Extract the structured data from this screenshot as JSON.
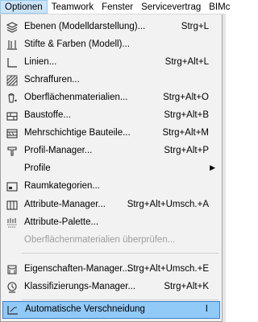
{
  "menubar": {
    "items": [
      "Optionen",
      "Teamwork",
      "Fenster",
      "Servicevertrag",
      "BIMc"
    ]
  },
  "menu": {
    "items": [
      {
        "label": "Ebenen (Modelldarstellung)...",
        "shortcut": "Strg+L",
        "icon": "layers-icon"
      },
      {
        "label": "Stifte & Farben (Modell)...",
        "shortcut": "",
        "icon": "pens-icon"
      },
      {
        "label": "Linien...",
        "shortcut": "Strg+Alt+L",
        "icon": "lines-icon"
      },
      {
        "label": "Schraffuren...",
        "shortcut": "",
        "icon": "hatch-icon"
      },
      {
        "label": "Oberflächenmaterialien...",
        "shortcut": "Strg+Alt+O",
        "icon": "paint-bucket-icon"
      },
      {
        "label": "Baustoffe...",
        "shortcut": "Strg+Alt+B",
        "icon": "building-material-icon"
      },
      {
        "label": "Mehrschichtige Bauteile...",
        "shortcut": "Strg+Alt+M",
        "icon": "composite-icon"
      },
      {
        "label": "Profil-Manager...",
        "shortcut": "Strg+Alt+P",
        "icon": "profile-icon"
      },
      {
        "label": "Profile",
        "shortcut": "",
        "icon": "",
        "submenu": true
      },
      {
        "label": "Raumkategorien...",
        "shortcut": "",
        "icon": "zone-category-icon"
      },
      {
        "label": "Attribute-Manager...",
        "shortcut": "Strg+Alt+Umsch.+A",
        "icon": "attribute-manager-icon"
      },
      {
        "label": "Attribute-Palette...",
        "shortcut": "",
        "icon": "attribute-palette-icon"
      },
      {
        "label": "Oberflächenmaterialien überprüfen...",
        "shortcut": "",
        "icon": "",
        "disabled": true
      },
      {
        "label": "Eigenschaften-Manager...",
        "shortcut": "Strg+Alt+Umsch.+E",
        "icon": "property-manager-icon"
      },
      {
        "label": "Klassifizierungs-Manager...",
        "shortcut": "Strg+Alt+K",
        "icon": "classification-icon"
      },
      {
        "label": "Automatische Verschneidung",
        "shortcut": "I",
        "icon": "auto-intersection-icon",
        "highlighted": true
      }
    ]
  }
}
